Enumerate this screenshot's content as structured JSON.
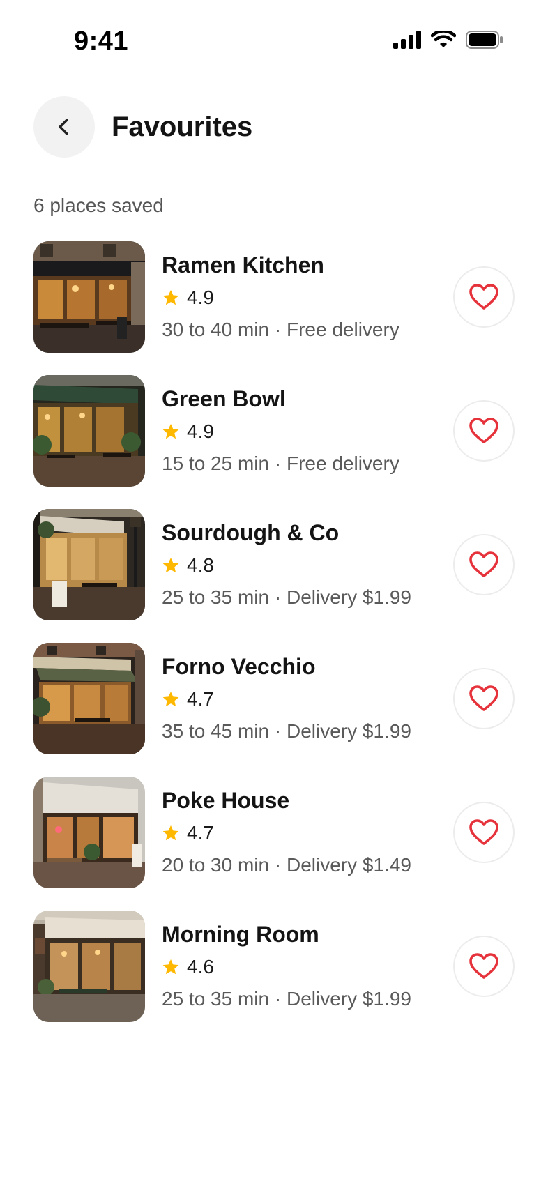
{
  "status_bar": {
    "time": "9:41"
  },
  "header": {
    "title": "Favourites",
    "back_icon": "chevron-left-icon"
  },
  "saved_count": "6 places saved",
  "colors": {
    "heart": "#e5323b",
    "star": "#ffb800",
    "back_bg": "#f2f2f2"
  },
  "places": [
    {
      "name": "Ramen Kitchen",
      "rating": "4.9",
      "meta": "30 to 40 min · Free delivery"
    },
    {
      "name": "Green Bowl",
      "rating": "4.9",
      "meta": "15 to 25 min · Free delivery"
    },
    {
      "name": "Sourdough & Co",
      "rating": "4.8",
      "meta": "25 to 35 min · Delivery $1.99"
    },
    {
      "name": "Forno Vecchio",
      "rating": "4.7",
      "meta": "35 to 45 min · Delivery $1.99"
    },
    {
      "name": "Poke House",
      "rating": "4.7",
      "meta": "20 to 30 min · Delivery $1.49"
    },
    {
      "name": "Morning Room",
      "rating": "4.6",
      "meta": "25 to 35 min · Delivery $1.99"
    }
  ]
}
